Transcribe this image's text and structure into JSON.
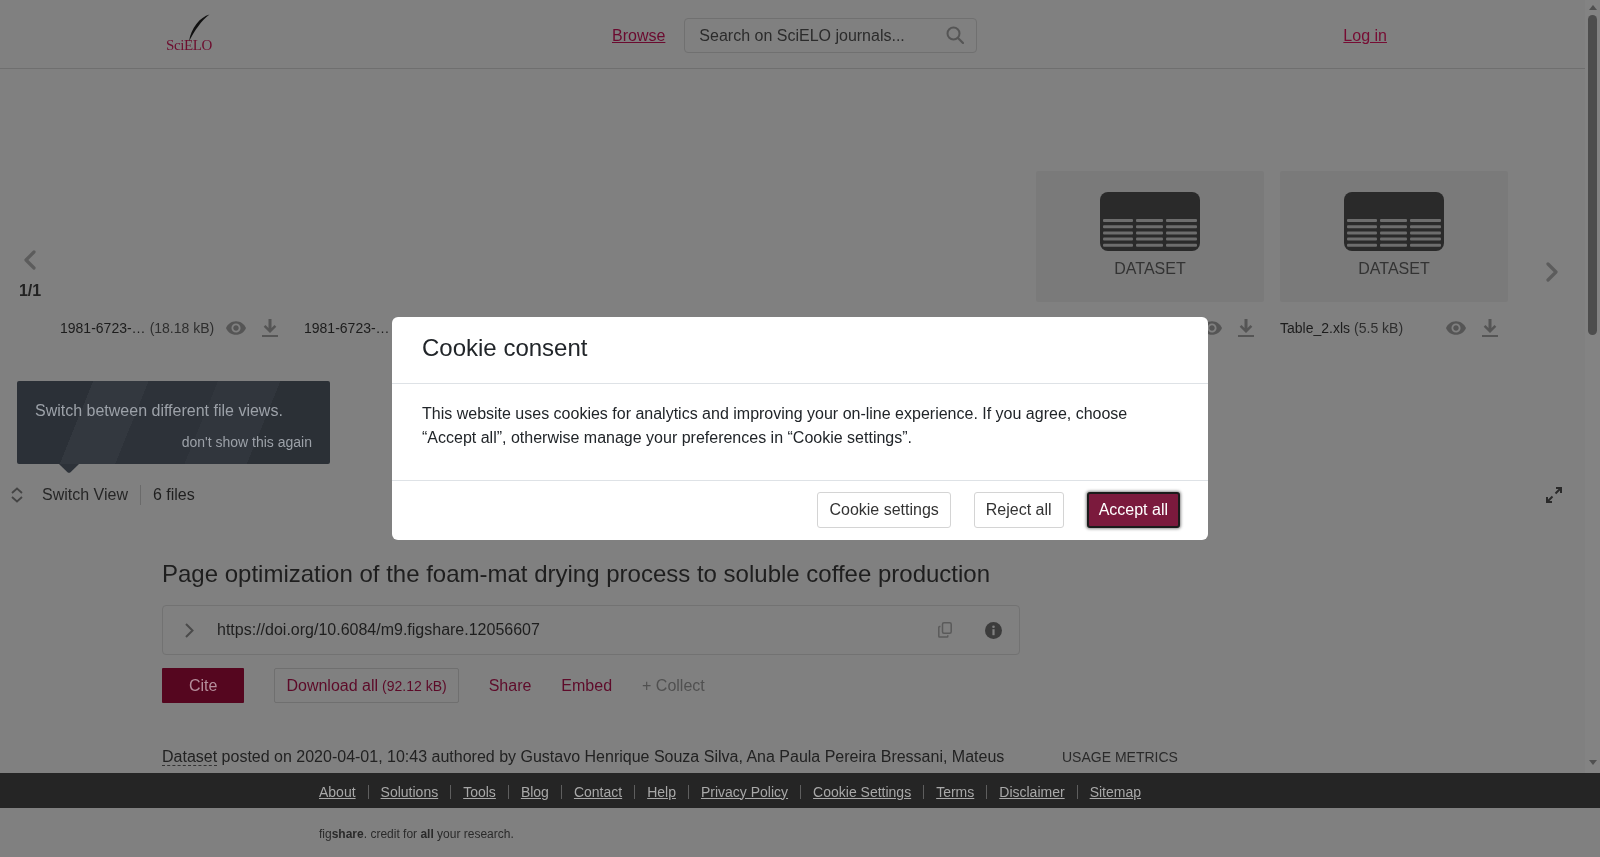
{
  "header": {
    "logo": "SciELO",
    "nav_link": "Browse",
    "search": {
      "placeholder": "Search on SciELO journals..."
    },
    "login": "Log in"
  },
  "carousel": {
    "page": "1/1",
    "items": [
      {
        "kind": "file",
        "name": "1981-6723-…",
        "size": "(18.18 kB)"
      },
      {
        "kind": "clipped",
        "name": "1981-6723-…"
      },
      {
        "kind": "covered"
      },
      {
        "kind": "covered"
      },
      {
        "kind": "file",
        "thumbnail_label": "DATASET"
      },
      {
        "kind": "file",
        "thumbnail_label": "DATASET",
        "name": "Table_2.xls",
        "size": "(5.5 kB)"
      }
    ]
  },
  "tooltip": {
    "text": "Switch between different file views.",
    "dismiss": "don't show this again"
  },
  "file_bar": {
    "switch_label": "Switch View",
    "file_count": "6 files"
  },
  "item": {
    "title": "Page optimization of the foam-mat drying process to soluble coffee production",
    "doi": "https://doi.org/10.6084/m9.figshare.12056607",
    "actions": [
      {
        "kind": "primary",
        "label": "Cite"
      },
      {
        "kind": "outline",
        "label": "Download all",
        "size": "(92.12 kB)"
      },
      {
        "kind": "link",
        "label": "Share"
      },
      {
        "kind": "link",
        "label": "Embed"
      },
      {
        "kind": "muted",
        "label": "+ Collect"
      }
    ],
    "posted": {
      "type_link": "Dataset",
      "text": "posted on 2020-04-01, 10:43 authored by Gustavo Henrique Souza Silva, Ana Paula Pereira Bressani, Mateus"
    },
    "usage_metrics": "USAGE METRICS"
  },
  "footer": {
    "links": [
      "About",
      "Solutions",
      "Tools",
      "Blog",
      "Contact",
      "Help",
      "Privacy Policy",
      "Cookie Settings",
      "Terms",
      "Disclaimer",
      "Sitemap"
    ],
    "tagline": "fig**share**. credit for **all** your research."
  },
  "cookie_dialog": {
    "title": "Cookie consent",
    "body": "This website uses cookies for analytics and improving your on-line experience. If you agree, choose “Accept all”, otherwise manage your preferences in “Cookie settings”.",
    "buttons": [
      {
        "kind": "outline",
        "label": "Cookie settings",
        "focused": false
      },
      {
        "kind": "outline",
        "label": "Reject all",
        "focused": false
      },
      {
        "kind": "primary",
        "label": "Accept all",
        "focused": true
      }
    ]
  }
}
